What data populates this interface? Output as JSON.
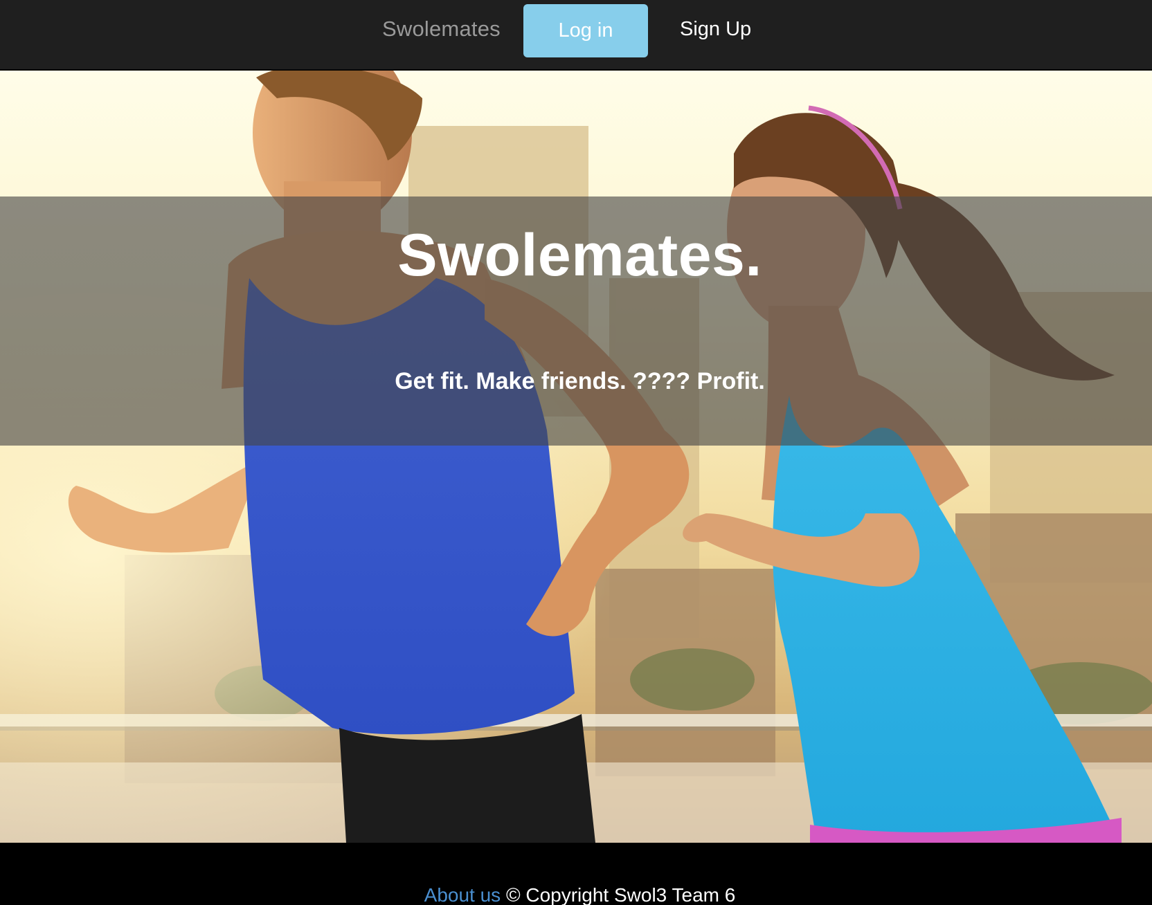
{
  "navbar": {
    "brand": "Swolemates",
    "login_label": "Log in",
    "signup_label": "Sign Up",
    "login_color": "#87ceeb",
    "background_color": "#1f1f1f"
  },
  "hero": {
    "title": "Swolemates.",
    "tagline": "Get fit. Make friends. ???? Profit."
  },
  "footer": {
    "about_label": "About us",
    "copyright": "© Copyright Swol3 Team 6",
    "link_color": "#4a8fd0"
  }
}
